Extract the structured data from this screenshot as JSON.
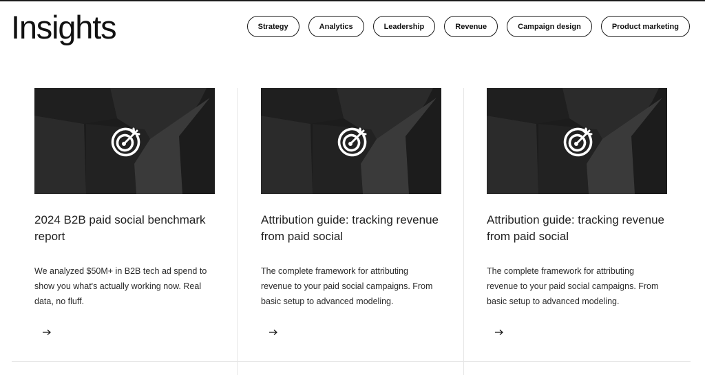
{
  "page": {
    "title": "Insights"
  },
  "filters": [
    {
      "label": "Strategy"
    },
    {
      "label": "Analytics"
    },
    {
      "label": "Leadership"
    },
    {
      "label": "Revenue"
    },
    {
      "label": "Campaign design"
    },
    {
      "label": "Product marketing"
    }
  ],
  "cards": [
    {
      "icon": "target-icon",
      "title": "2024 B2B paid social benchmark report",
      "description": "We analyzed $50M+ in B2B tech ad spend to show you what's actually working now. Real data, no fluff.",
      "cta_icon": "arrow-right-icon"
    },
    {
      "icon": "target-icon",
      "title": "Attribution guide: tracking revenue from paid social",
      "description": "The complete framework for attributing revenue to your paid social campaigns. From basic setup to advanced modeling.",
      "cta_icon": "arrow-right-icon"
    },
    {
      "icon": "target-icon",
      "title": "Attribution guide: tracking revenue from paid social",
      "description": "The complete framework for attributing revenue to your paid social campaigns. From basic setup to advanced modeling.",
      "cta_icon": "arrow-right-icon"
    }
  ],
  "colors": {
    "text": "#1a1a1a",
    "thumb_bg": "#1c1c1c",
    "shape_dark": "#2b2b2b",
    "shape_light": "#3a3a3a",
    "divider": "#e6e6e6"
  }
}
